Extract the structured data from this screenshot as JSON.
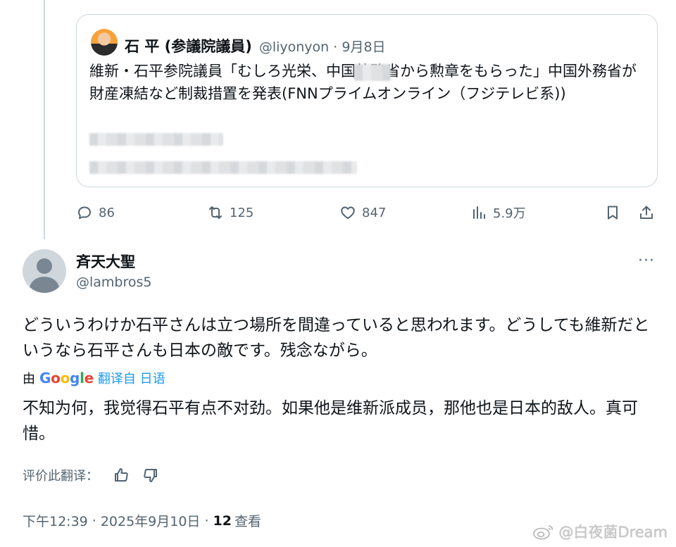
{
  "quote": {
    "author_name": "石 平 (参議院議員)",
    "handle": "@liyonyon",
    "separator": "·",
    "date": "9月8日",
    "text": "維新・石平参院議員「むしろ光栄、中国外務省から勲章をもらった」中国外務省が財産凍結など制裁措置を発表(FNNプライムオンライン（フジテレビ系))"
  },
  "actions": {
    "replies": "86",
    "retweets": "125",
    "likes": "847",
    "views": "5.9万"
  },
  "reply": {
    "name": "斉天大聖",
    "handle": "@lambros5",
    "more": "···",
    "text": "どういうわけか石平さんは立つ場所を間違っていると思われます。どうしても維新だというなら石平さんも日本の敵です。残念ながら。",
    "translate_prefix": "由",
    "google_logo": [
      "G",
      "o",
      "o",
      "g",
      "l",
      "e"
    ],
    "translate_link": "翻译自 日语",
    "translated_text": "不知为何，我觉得石平有点不对劲。如果他是维新派成员，那他也是日本的敌人。真可惜。",
    "rate_label": "评价此翻译：",
    "time": "下午12:39",
    "date": "2025年9月10日",
    "views_count": "12",
    "views_label": "查看"
  },
  "watermark": "@白夜菌Dream",
  "colors": {
    "link": "#1d9bf0",
    "secondary_text": "#536471",
    "border": "#cfd9de"
  }
}
